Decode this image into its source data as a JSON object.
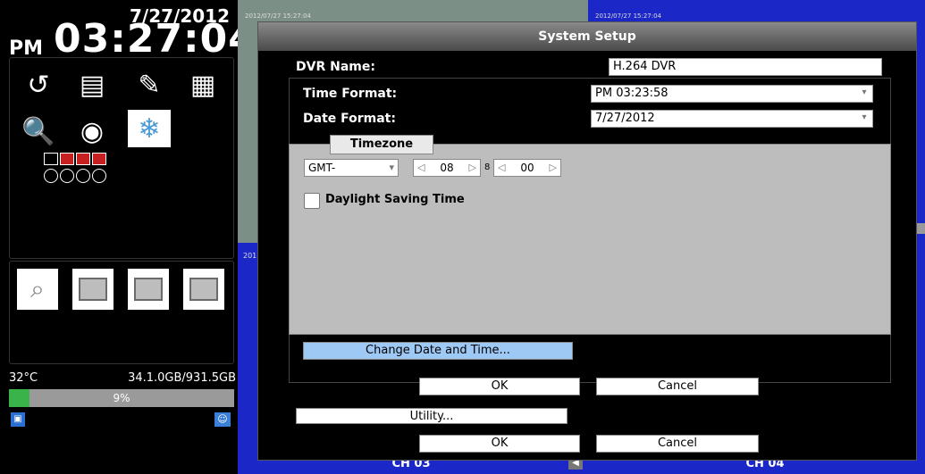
{
  "clock": {
    "date": "7/27/2012",
    "ampm": "PM",
    "time": "03:27:04"
  },
  "left_tools": [
    "playback-icon",
    "folder-icon",
    "tools-icon",
    "schedule-icon",
    "search-log-icon",
    "camera-icon",
    "freeze-icon"
  ],
  "stats": {
    "temp": "32°C",
    "disk": "34.1.0GB/931.5GB",
    "usage_percent": 9,
    "usage_label": "9%"
  },
  "cameras": {
    "cam1_ts": "2012/07/27 15:27:04",
    "cam2_ts": "2012/07/27 15:27:04",
    "cam3_ts": "201",
    "ch3": "CH 03",
    "ch4": "CH 04"
  },
  "dialog": {
    "title": "System Setup",
    "dvr_name_label": "DVR Name:",
    "dvr_name_value": "H.264 DVR",
    "time_format_label": "Time Format:",
    "time_format_value": "PM 03:23:58",
    "date_format_label": "Date Format:",
    "date_format_value": "7/27/2012",
    "timezone_tab": "Timezone",
    "gmt_value": "GMT-",
    "hour_value": "08",
    "hour_suffix": "8",
    "minute_value": "00",
    "dst_label": "Daylight Saving Time",
    "change_btn": "Change Date and Time...",
    "ok_inner": "OK",
    "cancel_inner": "Cancel",
    "utility_btn": "Utility...",
    "ok_outer": "OK",
    "cancel_outer": "Cancel"
  }
}
